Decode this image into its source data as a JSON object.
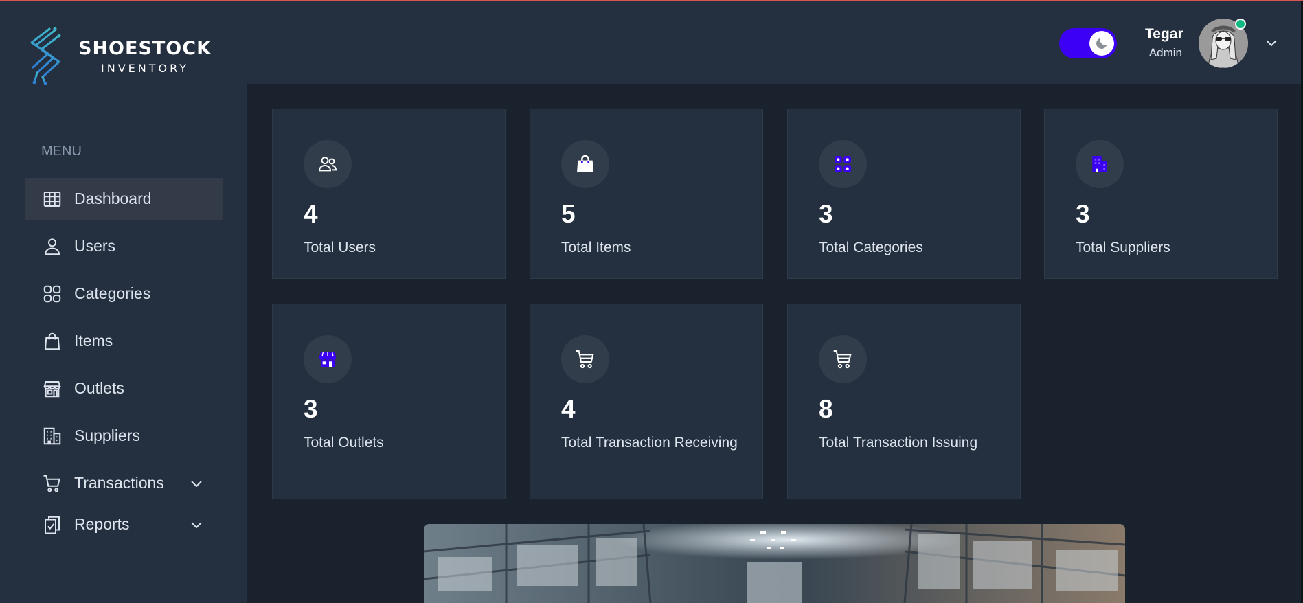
{
  "brand": {
    "title": "SHOESTOCK",
    "subtitle": "INVENTORY",
    "logo_icon": "circuit-s-logo"
  },
  "colors": {
    "sidebar_bg": "#24303f",
    "main_bg": "#1a222d",
    "card_bg": "#24303f",
    "accent": "#3c00f5",
    "online": "#10b981",
    "top_border": "#d9534f"
  },
  "sidebar": {
    "menu_label": "MENU",
    "items": [
      {
        "label": "Dashboard",
        "icon": "table-grid-icon",
        "active": true
      },
      {
        "label": "Users",
        "icon": "user-icon"
      },
      {
        "label": "Categories",
        "icon": "categories-icon"
      },
      {
        "label": "Items",
        "icon": "shopping-bag-icon"
      },
      {
        "label": "Outlets",
        "icon": "store-icon"
      },
      {
        "label": "Suppliers",
        "icon": "building-icon"
      },
      {
        "label": "Transactions",
        "icon": "cart-icon",
        "expandable": true
      },
      {
        "label": "Reports",
        "icon": "clipboard-check-icon",
        "expandable": true
      }
    ]
  },
  "header": {
    "theme_toggle": {
      "state": "dark",
      "icon": "moon-icon"
    },
    "user": {
      "name": "Tegar",
      "role": "Admin",
      "online": true
    }
  },
  "stats": [
    {
      "value": "4",
      "label": "Total Users",
      "icon": "users-icon"
    },
    {
      "value": "5",
      "label": "Total Items",
      "icon": "shopping-bag-icon"
    },
    {
      "value": "3",
      "label": "Total Categories",
      "icon": "category-grid-icon"
    },
    {
      "value": "3",
      "label": "Total Suppliers",
      "icon": "building-icon"
    },
    {
      "value": "3",
      "label": "Total Outlets",
      "icon": "store-icon"
    },
    {
      "value": "4",
      "label": "Total Transaction Receiving",
      "icon": "cart-icon"
    },
    {
      "value": "8",
      "label": "Total Transaction Issuing",
      "icon": "cart-icon"
    }
  ],
  "hero_image": {
    "subject": "warehouse-shelves-photo"
  }
}
